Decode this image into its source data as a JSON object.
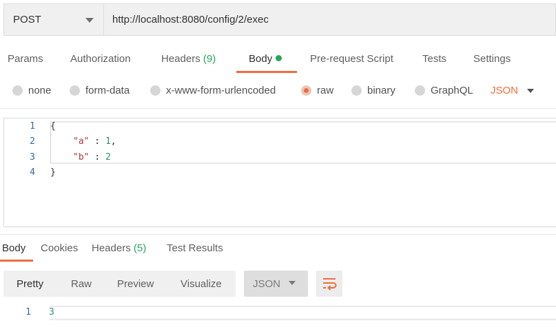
{
  "request": {
    "method": "POST",
    "url": "http://localhost:8080/config/2/exec"
  },
  "request_tabs": {
    "params": "Params",
    "authorization": "Authorization",
    "headers": "Headers",
    "headers_count": "(9)",
    "body": "Body",
    "pre_request": "Pre-request Script",
    "tests": "Tests",
    "settings": "Settings"
  },
  "body_types": {
    "none": "none",
    "form_data": "form-data",
    "urlencoded": "x-www-form-urlencoded",
    "raw": "raw",
    "binary": "binary",
    "graphql": "GraphQL",
    "selected": "raw",
    "language": "JSON"
  },
  "editor": {
    "line_numbers": [
      "1",
      "2",
      "3",
      "4"
    ],
    "line1": "{",
    "line2_key": "\"a\"",
    "line2_sep": " : ",
    "line2_val": "1",
    "line2_comma": ",",
    "line3_key": "\"b\"",
    "line3_sep": " : ",
    "line3_val": "2",
    "line4": "}"
  },
  "response_tabs": {
    "body": "Body",
    "cookies": "Cookies",
    "headers": "Headers",
    "headers_count": "(5)",
    "test_results": "Test Results"
  },
  "response_view": {
    "pretty": "Pretty",
    "raw": "Raw",
    "preview": "Preview",
    "visualize": "Visualize",
    "format": "JSON",
    "wrap_icon": "wrap-lines-icon"
  },
  "response": {
    "line_number": "1",
    "content": "3"
  },
  "colors": {
    "accent": "#f26b3a",
    "success": "#26a65b",
    "line_number": "#2b6ca8",
    "json_key": "#a33a35",
    "json_number": "#2c8f7a"
  }
}
